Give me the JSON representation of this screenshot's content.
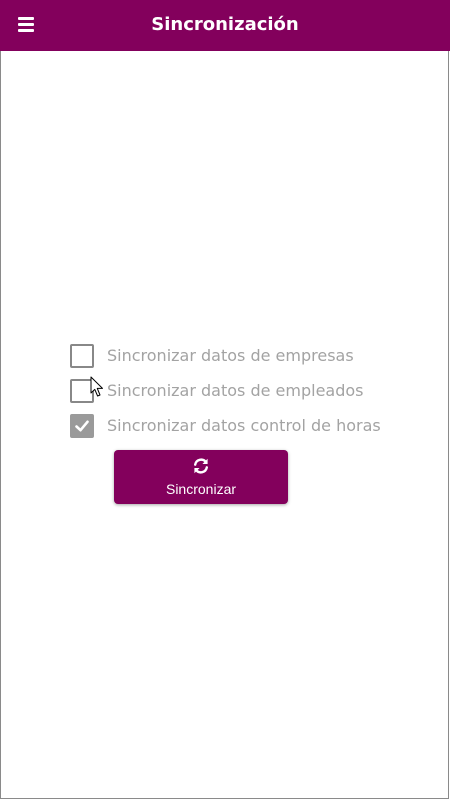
{
  "header": {
    "title": "Sincronización",
    "menu_icon": "hamburger-menu-icon",
    "background_color": "#83005c"
  },
  "options": [
    {
      "label": "Sincronizar datos de empresas",
      "checked": false
    },
    {
      "label": "Sincronizar datos de empleados",
      "checked": false
    },
    {
      "label": "Sincronizar datos control de horas",
      "checked": true
    }
  ],
  "sync_button": {
    "label": "Sincronizar",
    "icon": "refresh-icon",
    "background_color": "#83005c"
  },
  "colors": {
    "accent": "#83005c",
    "option_text": "#a3a3a3",
    "checkbox_border": "#888888",
    "checkbox_checked": "#9a9a9a"
  }
}
